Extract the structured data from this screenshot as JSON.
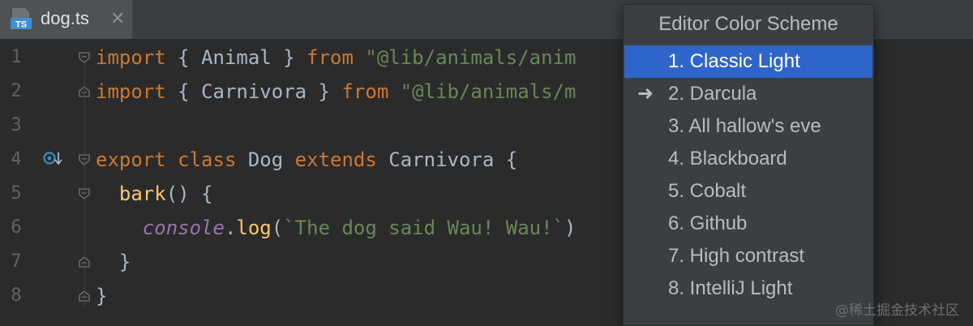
{
  "tab": {
    "title": "dog.ts",
    "icon_text": "TS",
    "close": "✕"
  },
  "editor": {
    "line_numbers": [
      "1",
      "2",
      "3",
      "4",
      "5",
      "6",
      "7",
      "8"
    ],
    "lines": {
      "l1": {
        "kw1": "import",
        "brace_open": " { ",
        "ident": "Animal",
        "brace_close": " } ",
        "kw2": "from",
        "space": " ",
        "str": "\"@lib/animals/anim"
      },
      "l2": {
        "kw1": "import",
        "brace_open": " { ",
        "ident": "Carnivora",
        "brace_close": " } ",
        "kw2": "from",
        "space": " ",
        "str": "\"@lib/animals/m"
      },
      "l4": {
        "kw1": "export",
        "sp1": " ",
        "kw2": "class",
        "sp2": " ",
        "ident": "Dog",
        "sp3": " ",
        "kw3": "extends",
        "rest": " Carnivora {"
      },
      "l5": {
        "indent": "  ",
        "fn": "bark",
        "rest": "() {"
      },
      "l6": {
        "indent": "    ",
        "glob": "console",
        "dot": ".",
        "fn": "log",
        "paren": "(",
        "str": "`The dog said Wau! Wau!`",
        "close": ")"
      },
      "l7": {
        "text": "  }"
      },
      "l8": {
        "text": "}"
      }
    }
  },
  "popup": {
    "title": "Editor Color Scheme",
    "items": [
      {
        "label": "1. Classic Light",
        "mark": ""
      },
      {
        "label": "2. Darcula",
        "mark": "➜"
      },
      {
        "label": "3. All hallow's eve",
        "mark": ""
      },
      {
        "label": "4. Blackboard",
        "mark": ""
      },
      {
        "label": "5. Cobalt",
        "mark": ""
      },
      {
        "label": "6. Github",
        "mark": ""
      },
      {
        "label": "7. High contrast",
        "mark": ""
      },
      {
        "label": "8. IntelliJ Light",
        "mark": ""
      }
    ]
  },
  "watermark": "@稀土掘金技术社区",
  "colors": {
    "keyword": "#cc7832",
    "string": "#6a8759",
    "function": "#ffc66d",
    "global": "#9876aa",
    "default": "#a9b7c6",
    "selection": "#2f65ca",
    "background": "#2b2b2b"
  }
}
